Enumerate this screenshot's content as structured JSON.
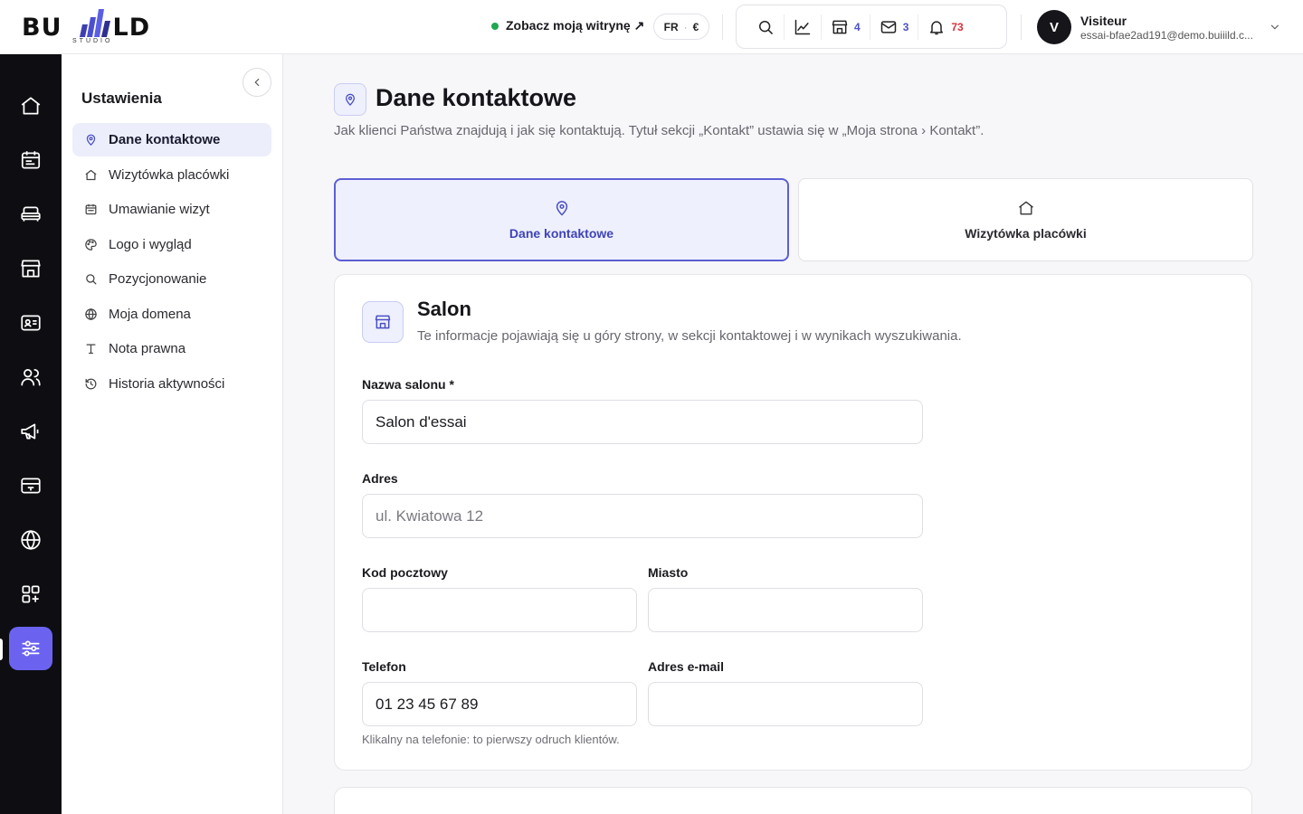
{
  "brand": {
    "name_left": "BU",
    "name_right": "LD",
    "subtitle": "STUDIO"
  },
  "header": {
    "site_link": "Zobacz moją witrynę ↗",
    "lang": "FR",
    "currency": "€",
    "counts": {
      "shop": "4",
      "mail": "3",
      "notifications": "73"
    },
    "user": {
      "initial": "V",
      "name": "Visiteur",
      "email": "essai-bfae2ad191@demo.buiiild.c..."
    }
  },
  "sidebar": {
    "title": "Ustawienia",
    "items": [
      {
        "label": "Dane kontaktowe",
        "icon": "map-pin-icon"
      },
      {
        "label": "Wizytówka placówki",
        "icon": "home-icon"
      },
      {
        "label": "Umawianie wizyt",
        "icon": "calendar-icon"
      },
      {
        "label": "Logo i wygląd",
        "icon": "palette-icon"
      },
      {
        "label": "Pozycjonowanie",
        "icon": "search-icon"
      },
      {
        "label": "Moja domena",
        "icon": "globe-icon"
      },
      {
        "label": "Nota prawna",
        "icon": "text-icon"
      },
      {
        "label": "Historia aktywności",
        "icon": "history-icon"
      }
    ]
  },
  "page": {
    "title": "Dane kontaktowe",
    "description": "Jak klienci Państwa znajdują i jak się kontaktują. Tytuł sekcji „Kontakt” ustawia się w „Moja strona › Kontakt”.",
    "tabs": [
      {
        "label": "Dane kontaktowe"
      },
      {
        "label": "Wizytówka placówki"
      }
    ]
  },
  "salon": {
    "title": "Salon",
    "description": "Te informacje pojawiają się u góry strony, w sekcji kontaktowej i w wynikach wyszukiwania.",
    "fields": {
      "name": {
        "label": "Nazwa salonu *",
        "value": "Salon d'essai",
        "placeholder": ""
      },
      "address": {
        "label": "Adres",
        "value": "",
        "placeholder": "ul. Kwiatowa 12"
      },
      "postal": {
        "label": "Kod pocztowy",
        "value": "",
        "placeholder": ""
      },
      "city": {
        "label": "Miasto",
        "value": "",
        "placeholder": ""
      },
      "phone": {
        "label": "Telefon",
        "value": "01 23 45 67 89",
        "placeholder": ""
      },
      "email": {
        "label": "Adres e-mail",
        "value": "",
        "placeholder": ""
      }
    },
    "phone_hint": "Klikalny na telefonie: to pierwszy odruch klientów."
  },
  "colors": {
    "accent": "#6b63f0",
    "accent_dark": "#3f44b8",
    "status_green": "#21a651",
    "alert_red": "#d9303a",
    "rail_bg": "#0e0e12"
  }
}
